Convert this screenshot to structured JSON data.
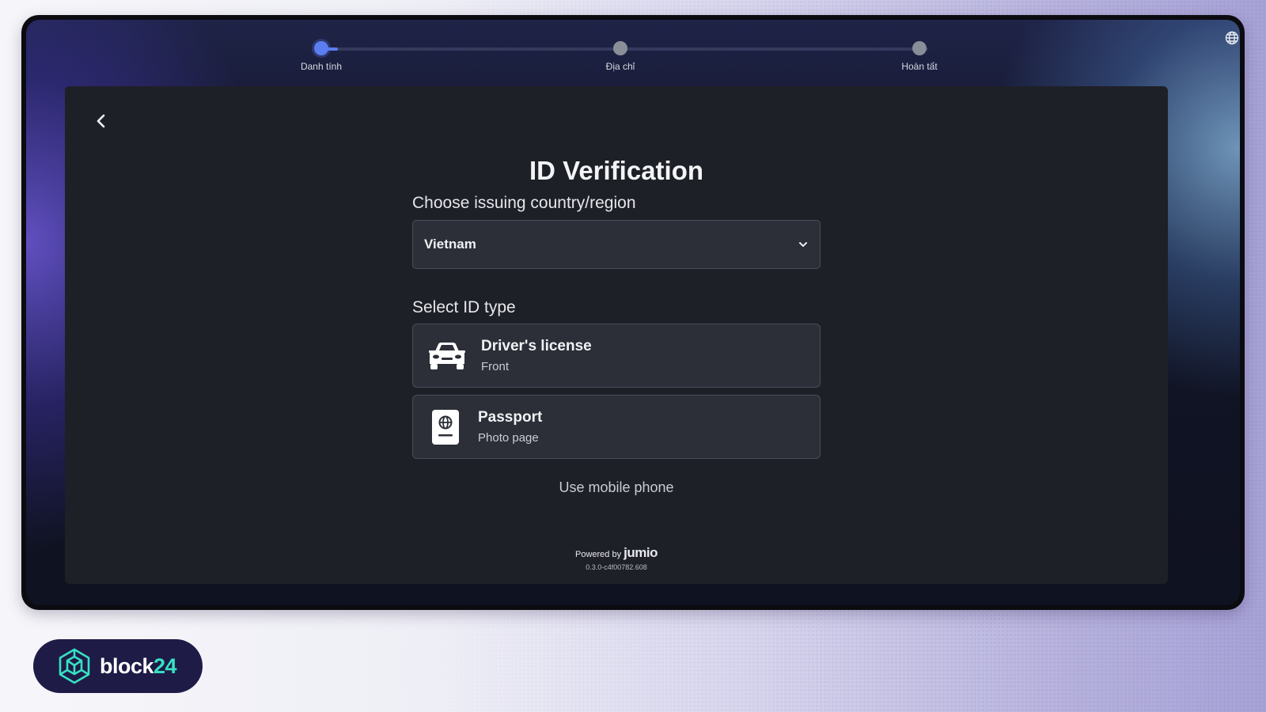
{
  "progress": {
    "steps": [
      {
        "label": "Danh tính"
      },
      {
        "label": "Địa chỉ"
      },
      {
        "label": "Hoàn tất"
      }
    ]
  },
  "page": {
    "title": "ID Verification",
    "country_label": "Choose issuing country/region",
    "country_value": "Vietnam",
    "id_type_label": "Select ID type",
    "options": [
      {
        "title": "Driver's license",
        "subtitle": "Front",
        "icon": "car-icon"
      },
      {
        "title": "Passport",
        "subtitle": "Photo page",
        "icon": "passport-icon"
      }
    ],
    "mobile_link": "Use mobile phone"
  },
  "footer": {
    "powered_by": "Powered by",
    "brand": "jumio",
    "version": "0.3.0-c4f00782.608"
  },
  "watermark": {
    "text_main": "block",
    "text_accent": "24"
  },
  "colors": {
    "accent": "#5b7df0",
    "card_bg": "#1e2027",
    "logo_accent": "#36e1c3"
  }
}
